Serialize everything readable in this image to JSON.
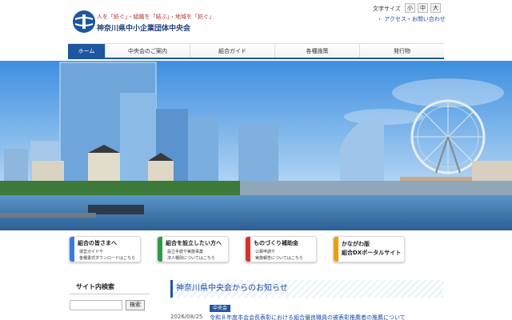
{
  "header": {
    "tagline": "人を「紡ぐ」・組織を「結ぶ」・地域を「紡ぐ」",
    "org_name": "神奈川県中小企業団体中央会",
    "font_size_label": "文字サイズ",
    "font_sizes": [
      "小",
      "中",
      "大"
    ],
    "access_link": "・ アクセス・お問い合わせ"
  },
  "nav": {
    "items": [
      "ホーム",
      "中央会のご案内",
      "組合ガイド",
      "各種施策",
      "発行物"
    ],
    "active_index": 0
  },
  "banners": [
    {
      "title": "組合の皆さまへ",
      "lines": [
        "運営ガイドや",
        "各種書式ダウンロードはこちら"
      ],
      "color": "#3a7bd5"
    },
    {
      "title": "組合を設立したい方へ",
      "lines": [
        "設立手続や実施事業",
        "法人種別についてはこちら"
      ],
      "color": "#2e9a46"
    },
    {
      "title": "ものづくり補助金",
      "lines": [
        "公募申請や",
        "実施報告についてはこちら"
      ],
      "color": "#d63030"
    },
    {
      "title": "かながわ版\n組合DXポータルサイト",
      "lines": [],
      "color": "#e8a10c"
    }
  ],
  "sidebar": {
    "search_heading": "サイト内検索",
    "search_placeholder": "",
    "search_button": "検索"
  },
  "news": {
    "heading": "神奈川県中央会からのお知らせ",
    "items": [
      {
        "badge": "中央会",
        "date": "2026/08/25",
        "title": "令和８年度本会会長表彰における組合優良職員の被表彰推薦者の推薦について"
      }
    ]
  },
  "colors": {
    "brand": "#1e56a0",
    "tagline": "#b33333"
  }
}
